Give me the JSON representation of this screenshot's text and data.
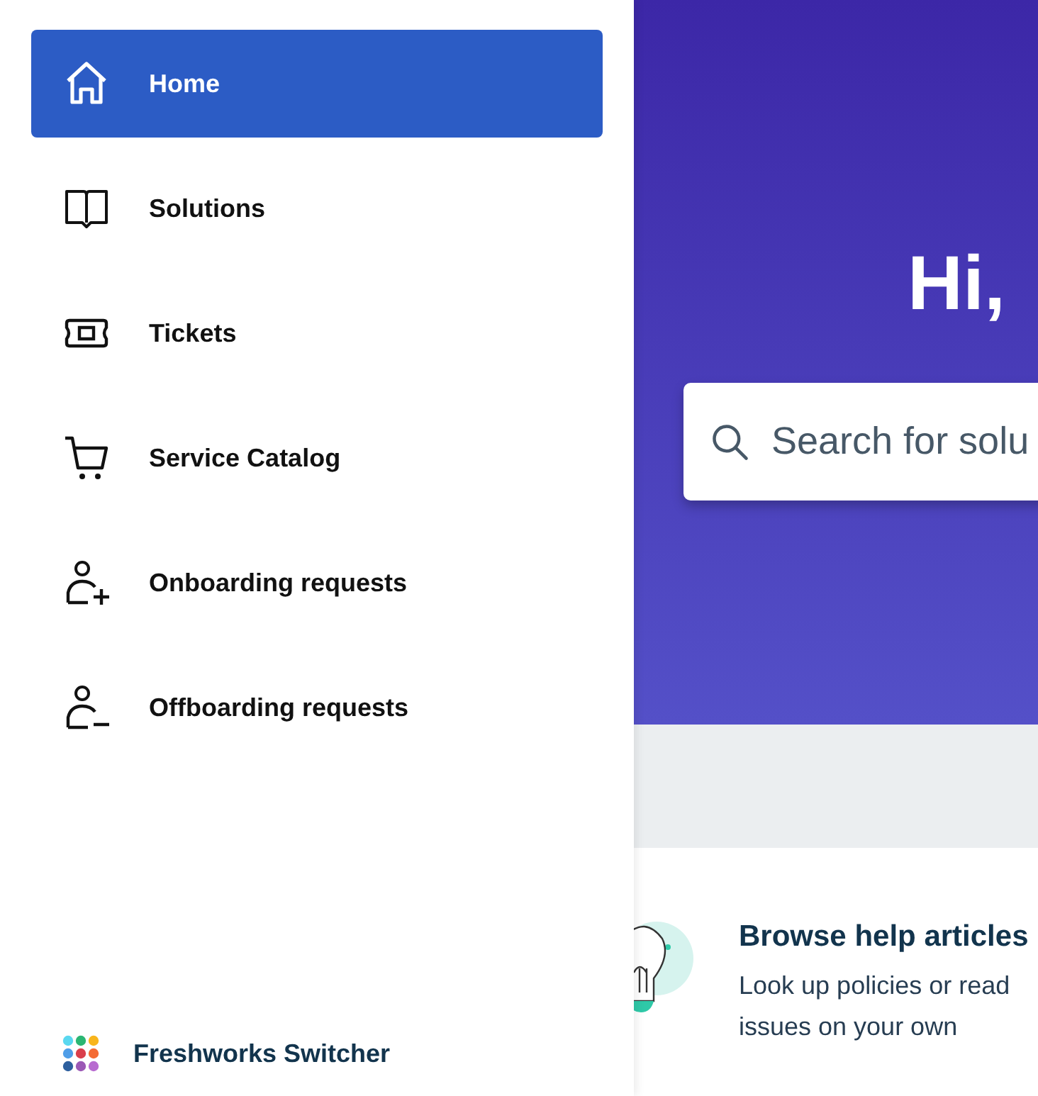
{
  "sidebar": {
    "items": [
      {
        "label": "Home",
        "selected": true
      },
      {
        "label": "Solutions",
        "selected": false
      },
      {
        "label": "Tickets",
        "selected": false
      },
      {
        "label": "Service Catalog",
        "selected": false
      },
      {
        "label": "Onboarding requests",
        "selected": false
      },
      {
        "label": "Offboarding requests",
        "selected": false
      }
    ],
    "switcher": {
      "label": "Freshworks Switcher"
    }
  },
  "hero": {
    "greeting": "Hi,",
    "search": {
      "placeholder": "Search for solu"
    }
  },
  "card": {
    "title": "Browse help articles",
    "description": "Look up policies or read",
    "description_2": "issues on your own"
  }
}
